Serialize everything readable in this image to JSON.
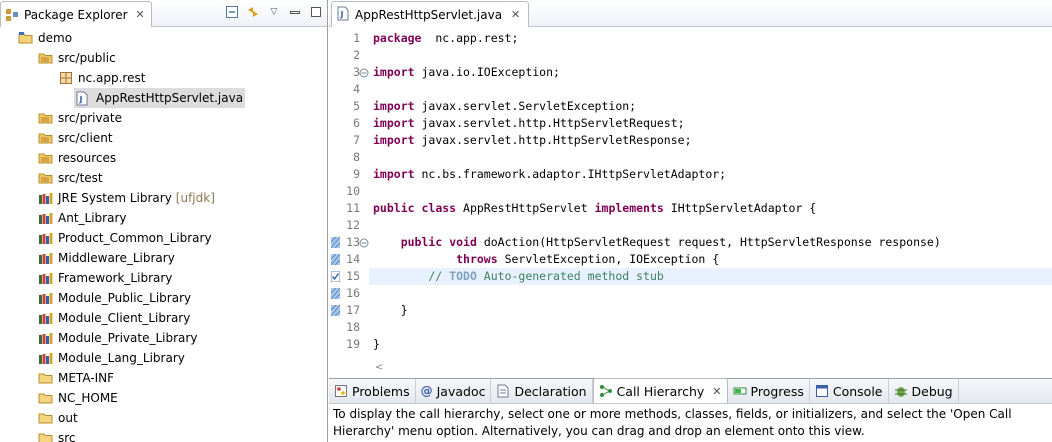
{
  "package_explorer": {
    "title": "Package Explorer",
    "tree": [
      {
        "label": "demo",
        "icon": "project-icon",
        "decoration": ""
      },
      {
        "label": "src/public",
        "icon": "source-folder-icon",
        "decoration": ""
      },
      {
        "label": "nc.app.rest",
        "icon": "package-icon",
        "decoration": ""
      },
      {
        "label": "AppRestHttpServlet.java",
        "icon": "java-file-icon",
        "decoration": ""
      },
      {
        "label": "src/private",
        "icon": "source-folder-icon",
        "decoration": ""
      },
      {
        "label": "src/client",
        "icon": "source-folder-icon",
        "decoration": ""
      },
      {
        "label": "resources",
        "icon": "source-folder-icon",
        "decoration": ""
      },
      {
        "label": "src/test",
        "icon": "source-folder-icon",
        "decoration": ""
      },
      {
        "label": "JRE System Library",
        "icon": "library-icon",
        "decoration": "[ufjdk]"
      },
      {
        "label": "Ant_Library",
        "icon": "library-icon",
        "decoration": ""
      },
      {
        "label": "Product_Common_Library",
        "icon": "library-icon",
        "decoration": ""
      },
      {
        "label": "Middleware_Library",
        "icon": "library-icon",
        "decoration": ""
      },
      {
        "label": "Framework_Library",
        "icon": "library-icon",
        "decoration": ""
      },
      {
        "label": "Module_Public_Library",
        "icon": "library-icon",
        "decoration": ""
      },
      {
        "label": "Module_Client_Library",
        "icon": "library-icon",
        "decoration": ""
      },
      {
        "label": "Module_Private_Library",
        "icon": "library-icon",
        "decoration": ""
      },
      {
        "label": "Module_Lang_Library",
        "icon": "library-icon",
        "decoration": ""
      },
      {
        "label": "META-INF",
        "icon": "folder-icon",
        "decoration": ""
      },
      {
        "label": "NC_HOME",
        "icon": "folder-icon",
        "decoration": ""
      },
      {
        "label": "out",
        "icon": "folder-icon",
        "decoration": ""
      },
      {
        "label": "src",
        "icon": "folder-icon",
        "decoration": ""
      }
    ]
  },
  "editor": {
    "tab_title": "AppRestHttpServlet.java",
    "lines": [
      {
        "num": "1",
        "tokens": [
          [
            "kw",
            "package"
          ],
          [
            "",
            "  nc.app.rest;"
          ]
        ]
      },
      {
        "num": "2",
        "tokens": []
      },
      {
        "num": "3",
        "tokens": [
          [
            "kw",
            "import"
          ],
          [
            "",
            " java.io.IOException;"
          ]
        ]
      },
      {
        "num": "4",
        "tokens": []
      },
      {
        "num": "5",
        "tokens": [
          [
            "kw",
            "import"
          ],
          [
            "",
            " javax.servlet.ServletException;"
          ]
        ]
      },
      {
        "num": "6",
        "tokens": [
          [
            "kw",
            "import"
          ],
          [
            "",
            " javax.servlet.http.HttpServletRequest;"
          ]
        ]
      },
      {
        "num": "7",
        "tokens": [
          [
            "kw",
            "import"
          ],
          [
            "",
            " javax.servlet.http.HttpServletResponse;"
          ]
        ]
      },
      {
        "num": "8",
        "tokens": []
      },
      {
        "num": "9",
        "tokens": [
          [
            "kw",
            "import"
          ],
          [
            "",
            " nc.bs.framework.adaptor.IHttpServletAdaptor;"
          ]
        ]
      },
      {
        "num": "10",
        "tokens": []
      },
      {
        "num": "11",
        "tokens": [
          [
            "kw",
            "public"
          ],
          [
            "",
            " "
          ],
          [
            "kw",
            "class"
          ],
          [
            "",
            " AppRestHttpServlet "
          ],
          [
            "kw",
            "implements"
          ],
          [
            "",
            " IHttpServletAdaptor {"
          ]
        ]
      },
      {
        "num": "12",
        "tokens": []
      },
      {
        "num": "13",
        "tokens": [
          [
            "",
            "    "
          ],
          [
            "kw",
            "public"
          ],
          [
            "",
            " "
          ],
          [
            "kw",
            "void"
          ],
          [
            "",
            " doAction(HttpServletRequest request, HttpServletResponse response)"
          ]
        ]
      },
      {
        "num": "14",
        "tokens": [
          [
            "",
            "            "
          ],
          [
            "kw",
            "throws"
          ],
          [
            "",
            " ServletException, IOException {"
          ]
        ]
      },
      {
        "num": "15",
        "tokens": [
          [
            "",
            "        "
          ],
          [
            "cm",
            "// "
          ],
          [
            "cmt",
            "TODO"
          ],
          [
            "cm",
            " Auto-generated method stub"
          ]
        ]
      },
      {
        "num": "16",
        "tokens": []
      },
      {
        "num": "17",
        "tokens": [
          [
            "",
            "    }"
          ]
        ]
      },
      {
        "num": "18",
        "tokens": []
      },
      {
        "num": "19",
        "tokens": [
          [
            "",
            "}"
          ]
        ]
      }
    ]
  },
  "bottom_panel": {
    "tabs": [
      {
        "label": "Problems",
        "icon": "problems-icon"
      },
      {
        "label": "Javadoc",
        "icon": "javadoc-icon"
      },
      {
        "label": "Declaration",
        "icon": "declaration-icon"
      },
      {
        "label": "Call Hierarchy",
        "icon": "call-hierarchy-icon",
        "active": true
      },
      {
        "label": "Progress",
        "icon": "progress-icon"
      },
      {
        "label": "Console",
        "icon": "console-icon"
      },
      {
        "label": "Debug",
        "icon": "debug-icon"
      }
    ],
    "message": "To display the call hierarchy, select one or more methods, classes, fields, or initializers, and select the 'Open Call Hierarchy' menu option. Alternatively, you can drag and drop an element onto this view."
  },
  "colors": {
    "keyword": "#7f0055",
    "comment": "#3f7f5f",
    "todo": "#7f9fbf",
    "current_line": "#e8f2fe",
    "selection": "#dcdcdc"
  }
}
